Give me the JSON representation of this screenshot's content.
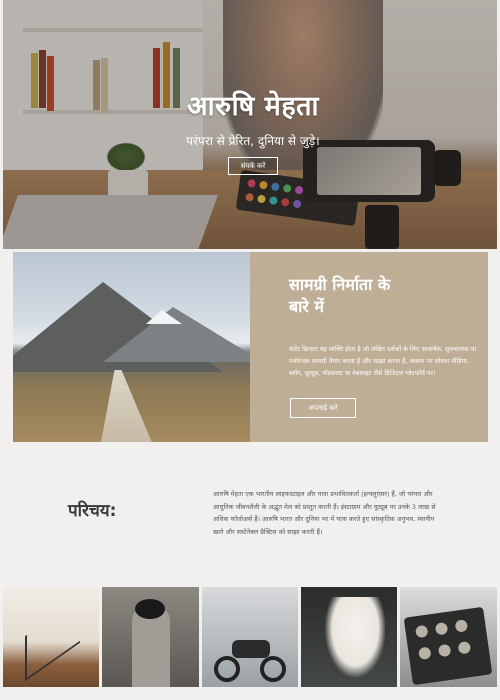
{
  "hero": {
    "title": "आरुषि मेहता",
    "tagline": "परंपरा से प्रेरित, दुनिया से जुड़े।",
    "cta_label": "संपर्क करें"
  },
  "about": {
    "heading": "सामग्री निर्माता के बारे में",
    "body": "कंटेंट क्रिएटर वह व्यक्ति होता है जो लक्षित दर्शकों के लिए आकर्षक, सूचनात्मक या मनोरंजक सामग्री तैयार करता है और साझा करता है, अक्सर पर सोशल मीडिया, ब्लॉग, यूट्यूब, पॉडकास्ट या वेबसाइट जैसे डिजिटल प्लेटफॉर्म पर।",
    "cta_label": "अपनाई करें"
  },
  "intro": {
    "title": "परिचय:",
    "body": "आरुषि मेहता एक भारतीय लाइफस्टाइल और यात्रा प्रभावितकर्ता (इन्फ्लुएंसर) हैं, जो परंपरा और आधुनिक जीवनशैली के अद्भुत मेल को प्रस्तुत करती हैं। इंस्टाग्राम और यूट्यूब पर उनके 3 लाख से अधिक फॉलोअर्स हैं। आरुषि भारत और दुनिया भर में यात्रा करते हुए सांस्कृतिक अनुभव, स्थानीय खाने और सस्टेनेबल प्रैक्टिस को साझा करती हैं।"
  },
  "gallery": {
    "items": [
      "interior-staircase",
      "portrait-hat",
      "motorcycle",
      "person-in-white",
      "watch-case"
    ]
  },
  "colors": {
    "panel": "#bfae96",
    "background": "#f1f0ee"
  }
}
